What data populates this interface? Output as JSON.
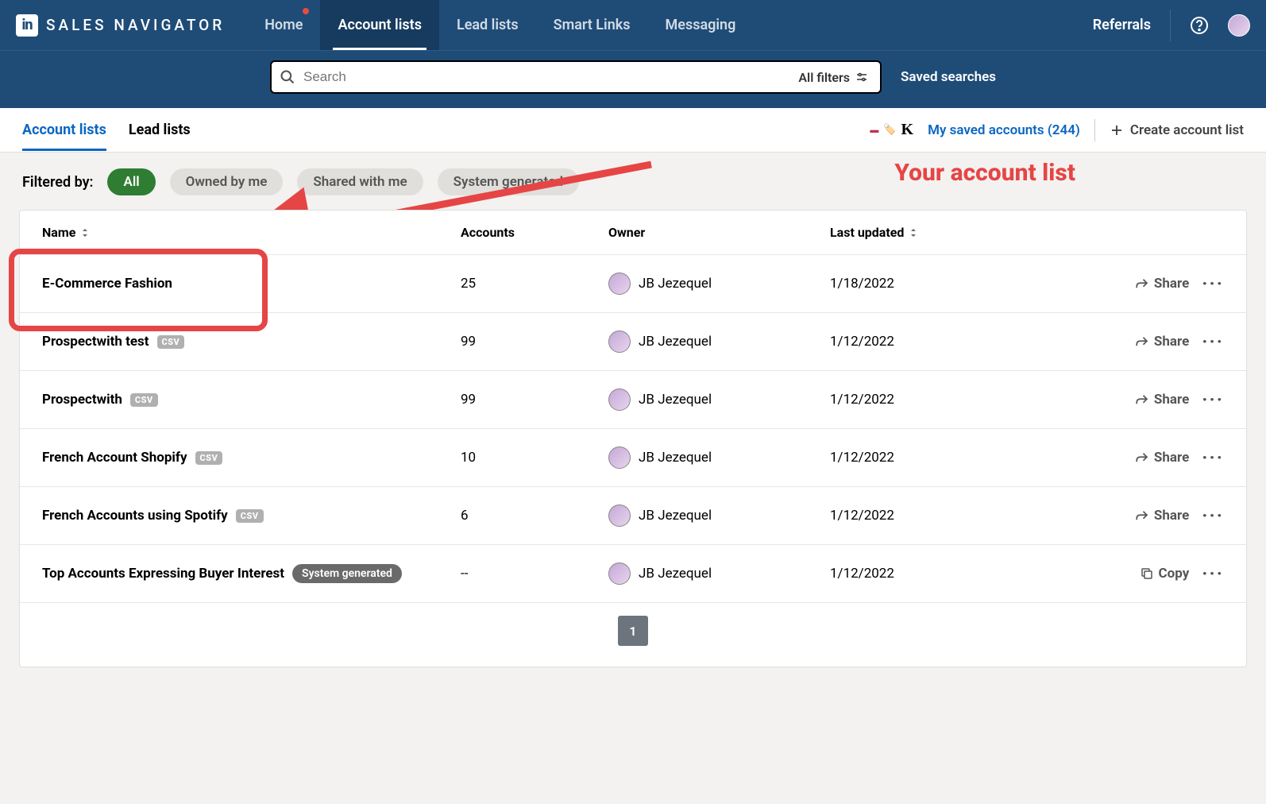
{
  "brand": "SALES NAVIGATOR",
  "nav": {
    "home": "Home",
    "account_lists": "Account lists",
    "lead_lists": "Lead lists",
    "smart_links": "Smart Links",
    "messaging": "Messaging",
    "referrals": "Referrals"
  },
  "search": {
    "placeholder": "Search",
    "all_filters": "All filters",
    "saved_searches": "Saved searches"
  },
  "subtabs": {
    "account_lists": "Account lists",
    "lead_lists": "Lead lists"
  },
  "subtabs_right": {
    "saved_accounts": "My saved accounts (244)",
    "create_list": "Create account list"
  },
  "filters": {
    "label": "Filtered by:",
    "pills": [
      "All",
      "Owned by me",
      "Shared with me",
      "System generated"
    ]
  },
  "annotation": "Your account list",
  "table": {
    "headers": {
      "name": "Name",
      "accounts": "Accounts",
      "owner": "Owner",
      "last_updated": "Last updated"
    },
    "share_label": "Share",
    "copy_label": "Copy",
    "csv_badge": "CSV",
    "system_badge": "System generated",
    "rows": [
      {
        "name": "E-Commerce Fashion",
        "badge": "",
        "accounts": "25",
        "owner": "JB Jezequel",
        "date": "1/18/2022",
        "action": "share"
      },
      {
        "name": "Prospectwith test",
        "badge": "csv",
        "accounts": "99",
        "owner": "JB Jezequel",
        "date": "1/12/2022",
        "action": "share"
      },
      {
        "name": "Prospectwith",
        "badge": "csv",
        "accounts": "99",
        "owner": "JB Jezequel",
        "date": "1/12/2022",
        "action": "share"
      },
      {
        "name": "French Account Shopify",
        "badge": "csv",
        "accounts": "10",
        "owner": "JB Jezequel",
        "date": "1/12/2022",
        "action": "share"
      },
      {
        "name": "French Accounts using Spotify",
        "badge": "csv",
        "accounts": "6",
        "owner": "JB Jezequel",
        "date": "1/12/2022",
        "action": "share"
      },
      {
        "name": "Top Accounts Expressing Buyer Interest",
        "badge": "system",
        "accounts": "--",
        "owner": "JB Jezequel",
        "date": "1/12/2022",
        "action": "copy"
      }
    ]
  },
  "pagination": {
    "current": "1"
  }
}
